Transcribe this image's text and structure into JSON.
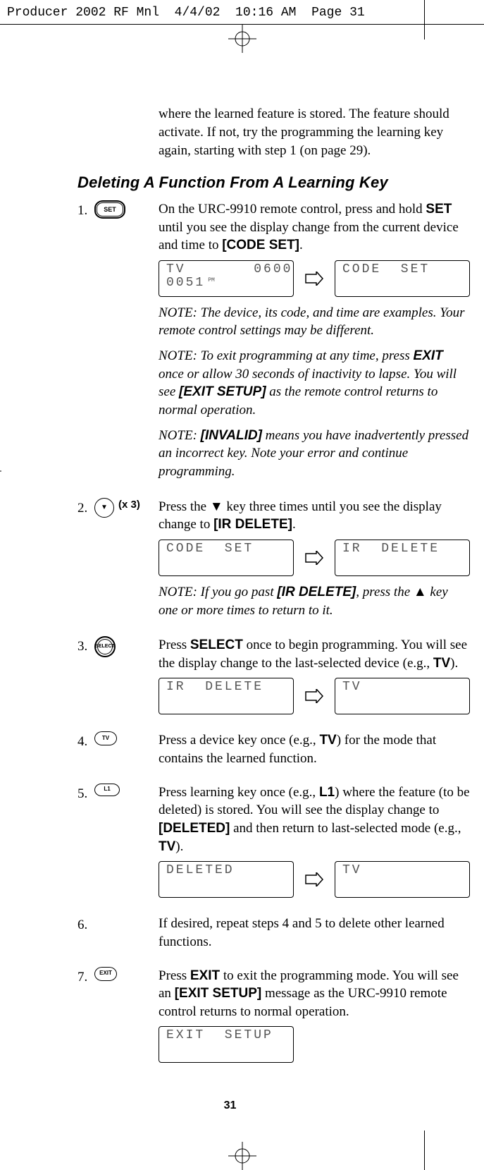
{
  "slug": "Producer 2002 RF Mnl  4/4/02  10:16 AM  Page 31",
  "intro": "where the learned feature is stored. The feature should activate. If not, try the programming the learning key again, starting with step 1 (on page 29).",
  "heading": "Deleting A Function From A Learning Key",
  "steps": {
    "s1": {
      "num": "1.",
      "icon_label": "SET",
      "text_a": "On the URC-9910 remote control, press and hold ",
      "text_b": "SET",
      "text_c": " until you see the display change from the current device and time to ",
      "text_d": "[CODE SET]",
      "text_e": ".",
      "lcd1_l1": "TV       0600",
      "lcd1_l2": "0051",
      "lcd1_pm": "PM",
      "lcd2": "CODE  SET",
      "note1_a": "NOTE: The device, its code, and time are examples. Your remote control settings may be different.",
      "note2_a": "NOTE: To exit programming at any time, press ",
      "note2_b": "EXIT",
      "note2_c": " once or allow 30 seconds of inactivity to lapse. You will see ",
      "note2_d": "[EXIT SETUP]",
      "note2_e": " as the remote control returns to normal operation.",
      "note3_a": "NOTE: ",
      "note3_b": "[INVALID]",
      "note3_c": " means you have inadvertently pressed an incorrect key. Note your error and continue programming."
    },
    "s2": {
      "num": "2.",
      "x3": "(x 3)",
      "text_a": "Press the ▼ key three times until you see the display change to ",
      "text_b": "[IR DELETE]",
      "text_c": ".",
      "lcd1": "CODE  SET",
      "lcd2": "IR  DELETE",
      "note_a": "NOTE: If you go past ",
      "note_b": "[IR DELETE]",
      "note_c": ", press the ▲ key one or more times to return to it."
    },
    "s3": {
      "num": "3.",
      "icon_label": "SELECT",
      "text_a": "Press ",
      "text_b": "SELECT",
      "text_c": " once to begin programming. You will see the display change to the last-selected device (e.g., ",
      "text_d": "TV",
      "text_e": ").",
      "lcd1": "IR  DELETE",
      "lcd2": "TV"
    },
    "s4": {
      "num": "4.",
      "icon_label": "TV",
      "text_a": "Press a device key once (e.g., ",
      "text_b": "TV",
      "text_c": ") for the mode that contains the learned function."
    },
    "s5": {
      "num": "5.",
      "icon_label": "L1",
      "text_a": "Press learning key once (e.g., ",
      "text_b": "L1",
      "text_c": ") where the feature (to be deleted) is stored. You will see the display change to ",
      "text_d": "[DELETED]",
      "text_e": " and then return to last-selected mode (e.g., ",
      "text_f": "TV",
      "text_g": ").",
      "lcd1": "DELETED",
      "lcd2": "TV"
    },
    "s6": {
      "num": "6.",
      "text": "If desired, repeat steps 4 and 5 to delete other learned functions."
    },
    "s7": {
      "num": "7.",
      "icon_label": "EXIT",
      "text_a": "Press ",
      "text_b": "EXIT",
      "text_c": " to exit the programming mode. You will see an ",
      "text_d": "[EXIT SETUP]",
      "text_e": " message as the URC-9910 remote control returns to normal operation.",
      "lcd1": "EXIT  SETUP"
    }
  },
  "page_number": "31"
}
